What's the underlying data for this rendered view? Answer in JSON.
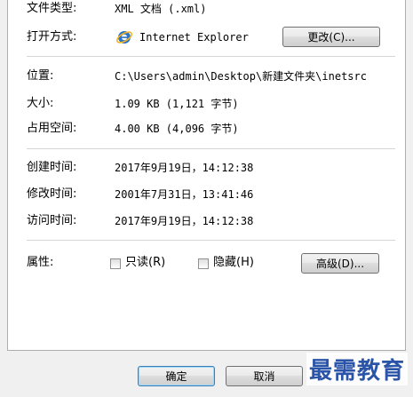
{
  "file_type": {
    "label": "文件类型:",
    "value": "XML 文档 (.xml)"
  },
  "opens_with": {
    "label": "打开方式:",
    "app_name": "Internet Explorer",
    "change_button": "更改(C)..."
  },
  "location": {
    "label": "位置:",
    "value": "C:\\Users\\admin\\Desktop\\新建文件夹\\inetsrc"
  },
  "size": {
    "label": "大小:",
    "value": "1.09 KB (1,121 字节)"
  },
  "size_on_disk": {
    "label": "占用空间:",
    "value": "4.00 KB (4,096 字节)"
  },
  "created": {
    "label": "创建时间:",
    "value": "2017年9月19日，14:12:38"
  },
  "modified": {
    "label": "修改时间:",
    "value": "2001年7月31日，13:41:46"
  },
  "accessed": {
    "label": "访问时间:",
    "value": "2017年9月19日，14:12:38"
  },
  "attributes": {
    "label": "属性:",
    "readonly_label": "只读(R)",
    "hidden_label": "隐藏(H)",
    "advanced_button": "高级(D)..."
  },
  "footer": {
    "ok_button": "确定",
    "cancel_button": "取消"
  },
  "watermark": "最需教育",
  "colors": {
    "ie_blue": "#2b73c8",
    "ie_ring": "#f2b424",
    "watermark": "#2a54a8"
  }
}
